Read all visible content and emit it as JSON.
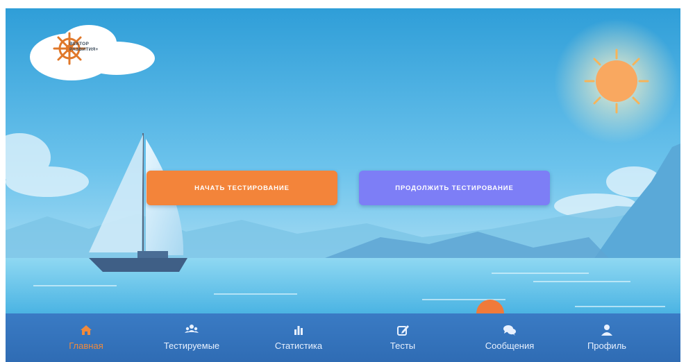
{
  "logo": {
    "line1": "ВЕКТОР",
    "line2": "РАЗВИТИЯ+",
    "icon": "ship-wheel-icon"
  },
  "actions": {
    "start_label": "НАЧАТЬ ТЕСТИРОВАНИЕ",
    "continue_label": "ПРОДОЛЖИТЬ ТЕСТИРОВАНИЕ"
  },
  "nav": {
    "items": [
      {
        "label": "Главная",
        "icon": "home-icon",
        "active": true
      },
      {
        "label": "Тестируемые",
        "icon": "users-icon",
        "active": false
      },
      {
        "label": "Статистика",
        "icon": "bar-chart-icon",
        "active": false
      },
      {
        "label": "Тесты",
        "icon": "edit-icon",
        "active": false
      },
      {
        "label": "Сообщения",
        "icon": "chat-icon",
        "active": false
      },
      {
        "label": "Профиль",
        "icon": "user-icon",
        "active": false
      }
    ]
  },
  "colors": {
    "start_button": "#f3843a",
    "continue_button": "#7d7ef6",
    "nav_background": "#336fb8",
    "nav_active": "#f08a3c",
    "nav_inactive": "#e8f1ff"
  }
}
